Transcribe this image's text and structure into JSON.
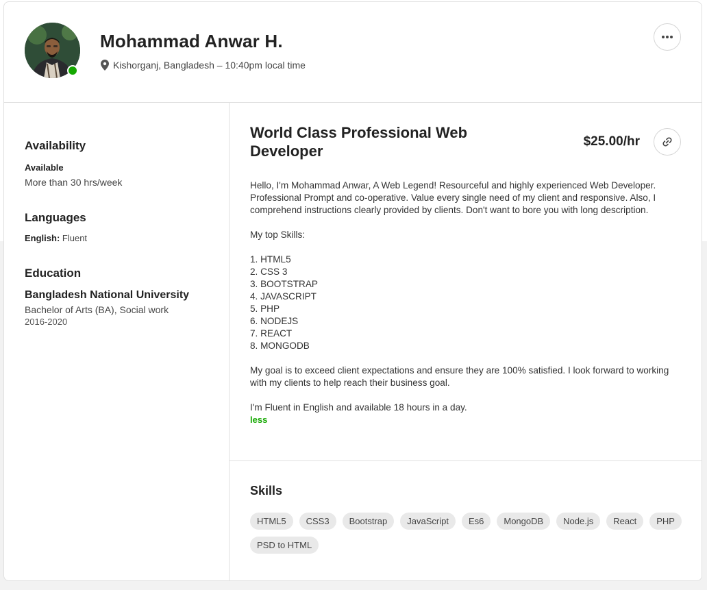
{
  "profile": {
    "name": "Mohammad Anwar H.",
    "location": "Kishorganj, Bangladesh",
    "local_time": "10:40pm local time",
    "status_color": "#14a800"
  },
  "icons": {
    "location": "map-pin-icon",
    "more": "ellipsis-icon",
    "link": "link-icon"
  },
  "sidebar": {
    "availability": {
      "heading": "Availability",
      "status": "Available",
      "hours": "More than 30 hrs/week"
    },
    "languages": {
      "heading": "Languages",
      "items": [
        {
          "language": "English:",
          "level": "Fluent"
        }
      ]
    },
    "education": {
      "heading": "Education",
      "school": "Bangladesh National University",
      "degree": "Bachelor of Arts (BA), Social work",
      "years": "2016-2020"
    }
  },
  "main": {
    "title": "World Class Professional Web Developer",
    "rate": "$25.00/hr",
    "overview": {
      "intro": "Hello, I'm Mohammad Anwar, A Web Legend! Resourceful and highly experienced Web Developer. Professional Prompt and co-operative. Value every single need of my client and responsive. Also, I comprehend instructions clearly provided by clients. Don't want to bore you with long description.",
      "skills_heading": "My top Skills:",
      "skills": [
        "1. HTML5",
        "2. CSS 3",
        "3. BOOTSTRAP",
        "4. JAVASCRIPT",
        "5. PHP",
        "6. NODEJS",
        "7. REACT",
        "8. MONGODB"
      ],
      "goal": "My goal is to exceed client expectations and ensure they are 100% satisfied. I look forward to working with my clients to help reach their business goal.",
      "closing": "I'm Fluent in English and available 18 hours in a day.",
      "less_label": "less"
    },
    "skills": {
      "heading": "Skills",
      "tags": [
        "HTML5",
        "CSS3",
        "Bootstrap",
        "JavaScript",
        "Es6",
        "MongoDB",
        "Node.js",
        "React",
        "PHP",
        "PSD to HTML"
      ]
    }
  }
}
